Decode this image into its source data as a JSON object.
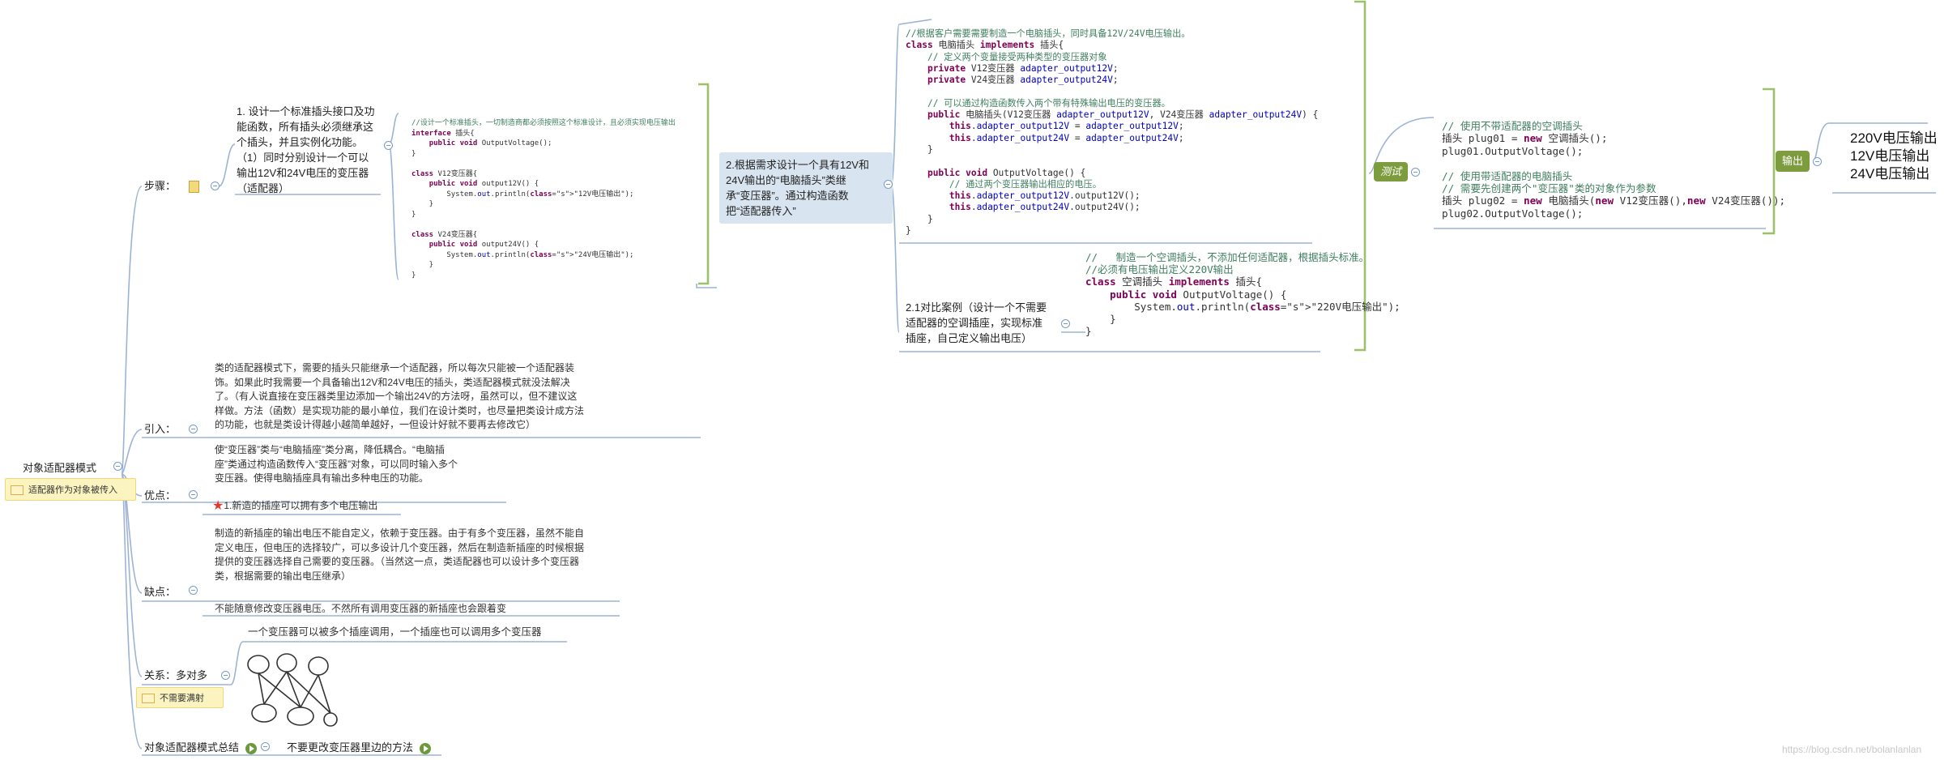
{
  "root": {
    "title": "对象适配器模式",
    "note": "适配器作为对象被传入"
  },
  "branches": {
    "steps": "步骤：",
    "intro": "引入：",
    "pros": "优点：",
    "cons": "缺点：",
    "relation": "关系：多对多",
    "relation_note": "不需要满射",
    "summary": "对象适配器模式总结",
    "summary_child": "不要更改变压器里边的方法"
  },
  "step1": {
    "lines": [
      "1. 设计一个标准插头接口及功",
      "能函数，所有插头必须继承这",
      "个插头，并且实例化功能。",
      "（1）同时分别设计一个可以",
      "输出12V和24V电压的变压器",
      "（适配器）"
    ]
  },
  "step2": {
    "lines": [
      "2.根据需求设计一个具有12V和",
      "24V输出的“电脑插头”类继",
      "承“变压器”。通过构造函数",
      "把“适配器传入”"
    ]
  },
  "step21": {
    "lines": [
      "2.1对比案例（设计一个不需要",
      "适配器的空调插座，实现标准",
      "插座，自己定义输出电压）"
    ]
  },
  "code1": [
    "//设计一个标准插头，一切制造商都必须按照这个标准设计，且必须实现电压输出",
    "interface 插头{",
    "    public void OutputVoltage();",
    "}",
    "",
    "class V12变压器{",
    "    public void output12V() {",
    "        System.out.println(\"12V电压输出\");",
    "    }",
    "}",
    "",
    "class V24变压器{",
    "    public void output24V() {",
    "        System.out.println(\"24V电压输出\");",
    "    }",
    "}"
  ],
  "code2": [
    "//根据客户需要需要制造一个电脑插头，同时具备12V/24V电压输出。",
    "class 电脑插头 implements 插头{",
    "    // 定义两个变量接受两种类型的变压器对象",
    "    private V12变压器 adapter_output12V;",
    "    private V24变压器 adapter_output24V;",
    "",
    "    // 可以通过构造函数传入两个带有特殊输出电压的变压器。",
    "    public 电脑插头(V12变压器 adapter_output12V, V24变压器 adapter_output24V) {",
    "        this.adapter_output12V = adapter_output12V;",
    "        this.adapter_output24V = adapter_output24V;",
    "    }",
    "",
    "    public void OutputVoltage() {",
    "        // 通过两个变压器输出相应的电压。",
    "        this.adapter_output12V.output12V();",
    "        this.adapter_output24V.output24V();",
    "    }",
    "}"
  ],
  "code3": [
    "//   制造一个空调插头，不添加任何适配器，根据插头标准。",
    "//必须有电压输出定义220V输出",
    "class 空调插头 implements 插头{",
    "    public void OutputVoltage() {",
    "        System.out.println(\"220V电压输出\");",
    "    }",
    "}"
  ],
  "code4": [
    "// 使用不带适配器的空调插头",
    "插头 plug01 = new 空调插头();",
    "plug01.OutputVoltage();",
    "",
    "// 使用带适配器的电脑插头",
    "// 需要先创建两个\"变压器\"类的对象作为参数",
    "插头 plug02 = new 电脑插头(new V12变压器(),new V24变压器());",
    "plug02.OutputVoltage();"
  ],
  "test_label": "测试",
  "output_label": "输出",
  "output_lines": [
    "220V电压输出",
    "12V电压输出",
    "24V电压输出"
  ],
  "intro_text": [
    "类的适配器模式下，需要的插头只能继承一个适配器，所以每次只能被一个适配器装",
    "饰。如果此时我需要一个具备输出12V和24V电压的插头，类适配器模式就没法解决",
    "了。（有人说直接在变压器类里边添加一个输出24V的方法呀，虽然可以，但不建议这",
    "样做。方法（函数）是实现功能的最小单位，我们在设计类时，也尽量把类设计成方法",
    "的功能，也就是类设计得越小越简单越好，一但设计好就不要再去修改它）"
  ],
  "pros_text": [
    "使“变压器”类与“电脑插座”类分离，降低耦合。“电脑插",
    "座”类通过构造函数传入“变压器”对象，可以同时输入多个",
    "变压器。使得电脑插座具有输出多种电压的功能。"
  ],
  "pros_item": "1.新造的插座可以拥有多个电压输出",
  "cons_text": [
    "制造的新插座的输出电压不能自定义，依赖于变压器。由于有多个变压器，虽然不能自",
    "定义电压，但电压的选择较广，可以多设计几个变压器，然后在制造新插座的时候根据",
    "提供的变压器选择自己需要的变压器。（当然这一点，类适配器也可以设计多个变压器",
    "类，根据需要的输出电压继承）"
  ],
  "cons_item": "不能随意修改变压器电压。不然所有调用变压器的新插座也会跟着变",
  "relation_text": "一个变压器可以被多个插座调用，一个插座也可以调用多个变压器",
  "watermark": "https://blog.csdn.net/bolanlanlan"
}
